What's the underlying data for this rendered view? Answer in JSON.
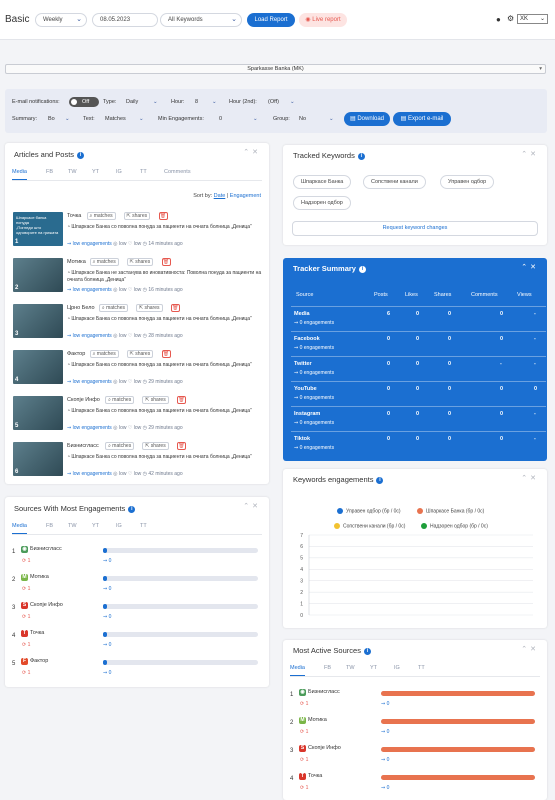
{
  "header": {
    "title": "Basic",
    "period": "Weekly",
    "date": "08.05.2023",
    "keywords_filter": "All Keywords",
    "load_label": "Load Report",
    "live_label": "Live report",
    "lang": "XK"
  },
  "client_select": "Sparkasse Banka (MK)",
  "filters": {
    "email_label": "E-mail notifications:",
    "email_toggle": "Off",
    "type_label": "Type:",
    "type_value": "Daily",
    "hour_label": "Hour:",
    "hour_value": "8",
    "hour2_label": "Hour (2nd):",
    "hour2_value": "(Off)",
    "summary_label": "Summary:",
    "summary_value": "Bo",
    "text_label": "Text:",
    "text_value": "Matches",
    "min_label": "Min Engagements:",
    "min_value": "0",
    "group_label": "Group:",
    "group_value": "No",
    "download_label": "Download",
    "export_label": "Export e-mail"
  },
  "articles": {
    "title": "Articles and Posts",
    "tabs": [
      "Media",
      "FB",
      "TW",
      "YT",
      "IG",
      "TT",
      "Comments"
    ],
    "sort_label": "Sort by:",
    "sort_date": "Date",
    "sort_sep": "|",
    "sort_eng": "Engagement",
    "matches_label": "matches",
    "shares_label": "shares",
    "items": [
      {
        "index": "1",
        "source": "Точка",
        "text": "Шпаркасе Банка со поволна понуда за пациенти на очната болница „Деница“",
        "eng": "low engagements",
        "a": "low",
        "b": "low",
        "time": "14 minutes ago",
        "thumb": "Шпаркасе банка\nпонуда\n„Погледи што одговорите на грижата"
      },
      {
        "index": "2",
        "source": "Мотика",
        "text": "Шпаркасе Банка не застанува во иновативноста: Поволна понуда за пациенти на очната болница „Деница“",
        "eng": "low engagements",
        "a": "low",
        "b": "low",
        "time": "16 minutes ago",
        "thumb": ""
      },
      {
        "index": "3",
        "source": "Црно Бело",
        "text": "Шпаркасе Банка со поволна понуда за пациенти на очната болница „Деница“",
        "eng": "low engagements",
        "a": "low",
        "b": "low",
        "time": "28 minutes ago",
        "thumb": ""
      },
      {
        "index": "4",
        "source": "Фактор",
        "text": "Шпаркасе Банка со поволна понуда за пациенти на очната болница „Деница“",
        "eng": "low engagements",
        "a": "low",
        "b": "low",
        "time": "29 minutes ago",
        "thumb": ""
      },
      {
        "index": "5",
        "source": "Скопје Инфо",
        "text": "Шпаркасе Банка со поволна понуда за пациенти на очната болница „Деница“",
        "eng": "low engagements",
        "a": "low",
        "b": "low",
        "time": "29 minutes ago",
        "thumb": ""
      },
      {
        "index": "6",
        "source": "Бизнисгласс",
        "text": "Шпаркасе Банка со поволна понуда за пациенти на очната болница „Деница“",
        "eng": "low engagements",
        "a": "low",
        "b": "low",
        "time": "42 minutes ago",
        "thumb": ""
      }
    ]
  },
  "tracked": {
    "title": "Tracked Keywords",
    "keywords": [
      "Шпаркасе Банка",
      "Сопствени канали",
      "Управен одбор",
      "Надзорен одбор"
    ],
    "request_label": "Request keyword changes"
  },
  "tracker": {
    "title": "Tracker Summary",
    "headers": [
      "Source",
      "Posts",
      "Likes",
      "Shares",
      "Comments",
      "Views"
    ],
    "rows": [
      {
        "name": "Media",
        "sub": "0 engagements",
        "posts": "6",
        "likes": "0",
        "shares": "0",
        "comments": "0",
        "views": "-"
      },
      {
        "name": "Facebook",
        "sub": "0 engagements",
        "posts": "0",
        "likes": "0",
        "shares": "0",
        "comments": "0",
        "views": "-"
      },
      {
        "name": "Twitter",
        "sub": "0 engagements",
        "posts": "0",
        "likes": "0",
        "shares": "0",
        "comments": "-",
        "views": "-"
      },
      {
        "name": "YouTube",
        "sub": "0 engagements",
        "posts": "0",
        "likes": "0",
        "shares": "0",
        "comments": "0",
        "views": "0"
      },
      {
        "name": "Instagram",
        "sub": "0 engagements",
        "posts": "0",
        "likes": "0",
        "shares": "0",
        "comments": "0",
        "views": "-"
      },
      {
        "name": "Tiktok",
        "sub": "0 engagements",
        "posts": "0",
        "likes": "0",
        "shares": "0",
        "comments": "0",
        "views": "-"
      }
    ]
  },
  "sources_eng": {
    "title": "Sources With Most Engagements",
    "tabs": [
      "Media",
      "FB",
      "TW",
      "YT",
      "IG",
      "TT"
    ],
    "items": [
      {
        "index": "1",
        "name": "Бизнисгласс",
        "val": "1",
        "eng": "0",
        "logo": "◉",
        "color": "#4b9b5a"
      },
      {
        "index": "2",
        "name": "Мотика",
        "val": "1",
        "eng": "0",
        "logo": "M",
        "color": "#7ab648"
      },
      {
        "index": "3",
        "name": "Скопје Инфо",
        "val": "1",
        "eng": "0",
        "logo": "S",
        "color": "#d9362b"
      },
      {
        "index": "4",
        "name": "Точка",
        "val": "1",
        "eng": "0",
        "logo": "T",
        "color": "#d9362b"
      },
      {
        "index": "5",
        "name": "Фактор",
        "val": "1",
        "eng": "0",
        "logo": "F",
        "color": "#e24b2b"
      }
    ],
    "bar_fraction": 0.02,
    "bar_color": "#1b6fd1"
  },
  "kw_eng": {
    "title": "Keywords engagements",
    "legend": [
      {
        "label": "Управен одбор (бр / 0с)",
        "color": "#1b6fd1"
      },
      {
        "label": "Шпаркасе Банка (бр / 0с)",
        "color": "#e8734f"
      },
      {
        "label": "Сопствени канали (бр / 0с)",
        "color": "#f2c230"
      },
      {
        "label": "Надзорен одбор (бр / 0с)",
        "color": "#1e9e3a"
      }
    ],
    "chart_data": {
      "type": "line",
      "yticks": [
        "7",
        "6",
        "5",
        "4",
        "3",
        "2",
        "1",
        "0"
      ],
      "ylim": [
        0,
        7
      ],
      "grid": true,
      "legend_position": "top"
    }
  },
  "most_active": {
    "title": "Most Active Sources",
    "tabs": [
      "Media",
      "FB",
      "TW",
      "YT",
      "IG",
      "TT"
    ],
    "items": [
      {
        "index": "1",
        "name": "Бизнисгласс",
        "val": "1",
        "eng": "0",
        "logo": "◉",
        "color": "#4b9b5a"
      },
      {
        "index": "2",
        "name": "Мотика",
        "val": "1",
        "eng": "0",
        "logo": "M",
        "color": "#7ab648"
      },
      {
        "index": "3",
        "name": "Скопје Инфо",
        "val": "1",
        "eng": "0",
        "logo": "S",
        "color": "#d9362b"
      },
      {
        "index": "4",
        "name": "Точка",
        "val": "1",
        "eng": "0",
        "logo": "T",
        "color": "#d9362b"
      }
    ],
    "bar_fraction": 1.0,
    "bar_color": "#e8734f"
  }
}
